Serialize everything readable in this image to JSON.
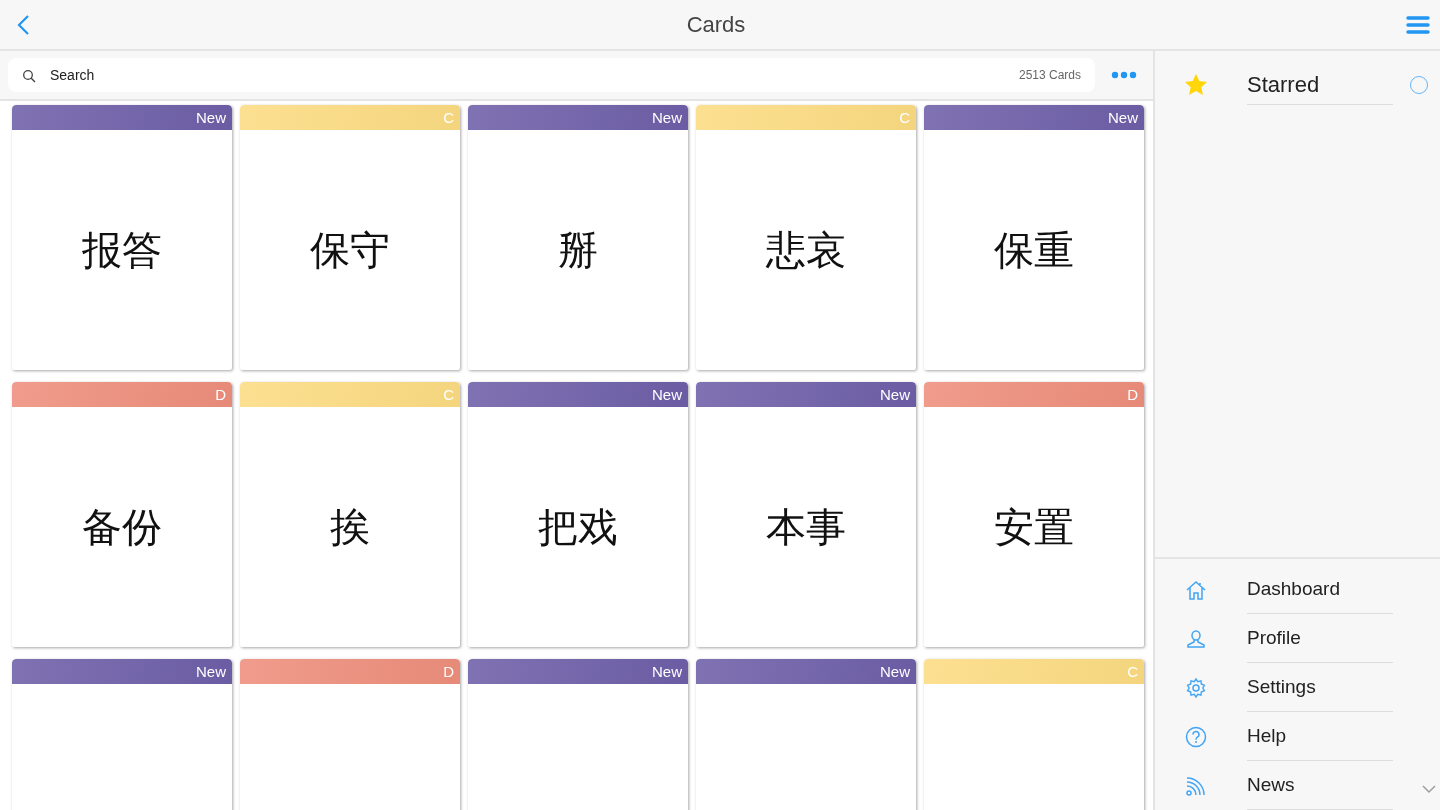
{
  "header": {
    "title": "Cards"
  },
  "search": {
    "placeholder": "Search",
    "count": "2513 Cards"
  },
  "cards": [
    {
      "color": "#6e5fa8",
      "label": "New",
      "word": "报答"
    },
    {
      "color": "#fcdc82",
      "label": "C",
      "word": "保守"
    },
    {
      "color": "#6e5fa8",
      "label": "New",
      "word": "掰"
    },
    {
      "color": "#fcdc82",
      "label": "C",
      "word": "悲哀"
    },
    {
      "color": "#6e5fa8",
      "label": "New",
      "word": "保重"
    },
    {
      "color": "#ee8e7c",
      "label": "D",
      "word": "备份"
    },
    {
      "color": "#fcdc82",
      "label": "C",
      "word": "挨"
    },
    {
      "color": "#6e5fa8",
      "label": "New",
      "word": "把戏"
    },
    {
      "color": "#6e5fa8",
      "label": "New",
      "word": "本事"
    },
    {
      "color": "#ee8e7c",
      "label": "D",
      "word": "安置"
    },
    {
      "color": "#6e5fa8",
      "label": "New"
    },
    {
      "color": "#ee8e7c",
      "label": "D"
    },
    {
      "color": "#6e5fa8",
      "label": "New"
    },
    {
      "color": "#6e5fa8",
      "label": "New"
    },
    {
      "color": "#fcdc82",
      "label": "C"
    }
  ],
  "side_panel": {
    "starred": {
      "label": "Starred",
      "selected": false
    },
    "nav": [
      {
        "label": "Dashboard"
      },
      {
        "label": "Profile"
      },
      {
        "label": "Settings"
      },
      {
        "label": "Help"
      },
      {
        "label": "News"
      }
    ]
  }
}
